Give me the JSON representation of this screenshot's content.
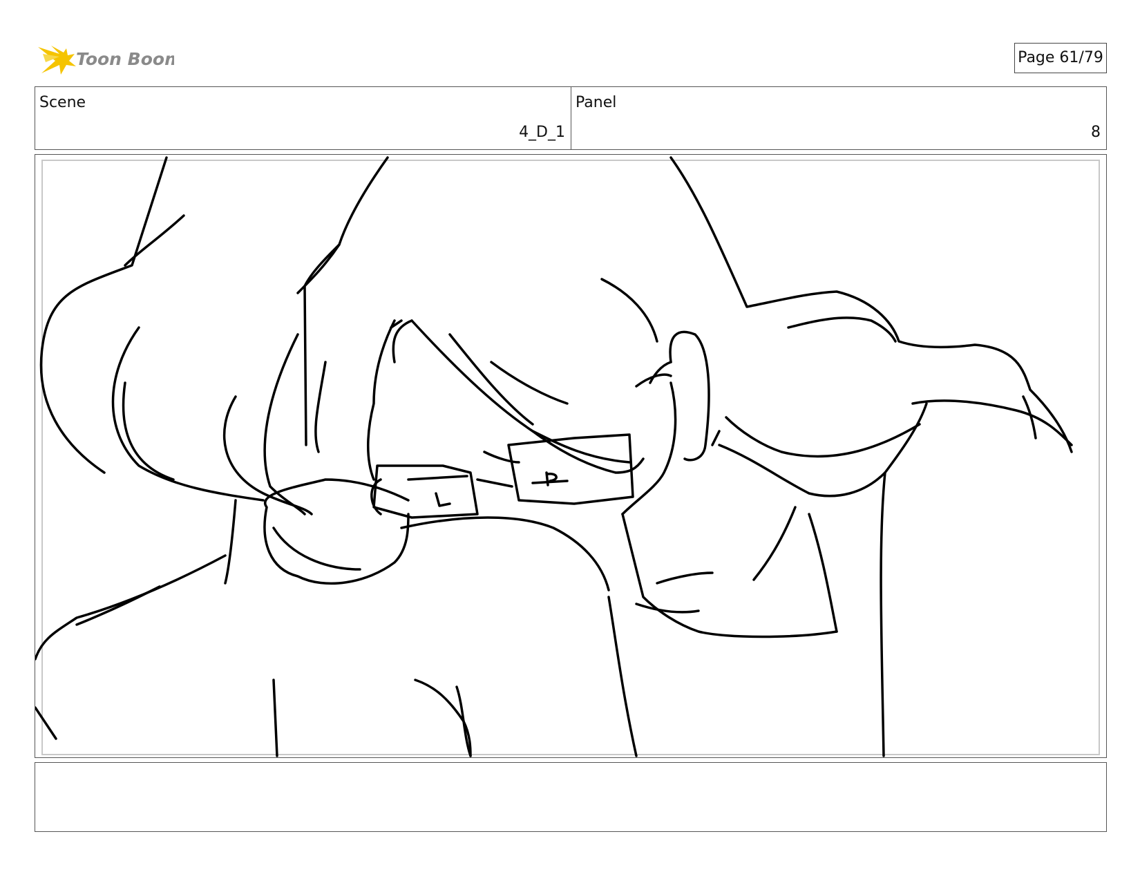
{
  "header": {
    "logo_text": "Toon Boom",
    "page_label": "Page 61/79"
  },
  "info": {
    "scene_label": "Scene",
    "scene_value": "4_D_1",
    "panel_label": "Panel",
    "panel_value": "8"
  },
  "notes": {
    "text": ""
  },
  "colors": {
    "logo_star": "#f5c400",
    "logo_text": "#8a8a8a",
    "ink": "#000000"
  }
}
